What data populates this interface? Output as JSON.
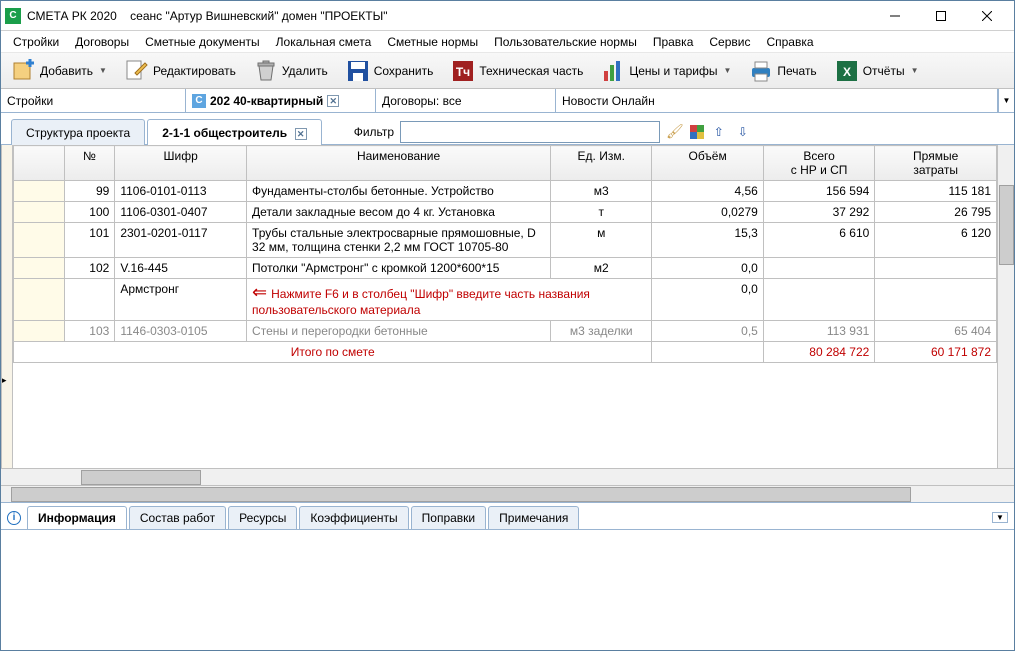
{
  "title": {
    "app": "СМЕТА РК 2020",
    "session": "сеанс \"Артур Вишневский\"  домен \"ПРОЕКТЫ\""
  },
  "menu": [
    "Стройки",
    "Договоры",
    "Сметные документы",
    "Локальная смета",
    "Сметные нормы",
    "Пользовательские нормы",
    "Правка",
    "Сервис",
    "Справка"
  ],
  "toolbar": {
    "add": "Добавить",
    "edit": "Редактировать",
    "delete": "Удалить",
    "save": "Сохранить",
    "tech": "Техническая часть",
    "prices": "Цены и тарифы",
    "print": "Печать",
    "reports": "Отчёты"
  },
  "docbar": {
    "section1": "Стройки",
    "active_doc": "202 40-квартирный",
    "contracts": "Договоры: все",
    "news": "Новости Онлайн"
  },
  "tabs": {
    "structure": "Структура проекта",
    "active": "2-1-1 общестроитель",
    "filter_label": "Фильтр"
  },
  "columns": {
    "num": "№",
    "code": "Шифр",
    "name": "Наименование",
    "unit": "Ед. Изм.",
    "volume": "Объём",
    "total": "Всего\nс НР и СП",
    "direct": "Прямые\nзатраты"
  },
  "rows": [
    {
      "num": "99",
      "code": "1106-0101-0113",
      "name": "Фундаменты-столбы бетонные. Устройство",
      "unit": "м3",
      "vol": "4,56",
      "total": "156 594",
      "direct": "115 181"
    },
    {
      "num": "100",
      "code": "1106-0301-0407",
      "name": "Детали закладные весом до 4 кг. Установка",
      "unit": "т",
      "vol": "0,0279",
      "total": "37 292",
      "direct": "26 795"
    },
    {
      "num": "101",
      "code": "2301-0201-0117",
      "name": "Трубы стальные электросварные прямошовные, D 32 мм, толщина стенки 2,2 мм ГОСТ 10705-80",
      "unit": "м",
      "vol": "15,3",
      "total": "6 610",
      "direct": "6 120"
    },
    {
      "num": "102",
      "code": "V.16-445",
      "name": "Потолки \"Армстронг\" с кромкой 1200*600*15",
      "unit": "м2",
      "vol": "0,0",
      "total": "",
      "direct": ""
    }
  ],
  "input_row": {
    "code": "Армстронг",
    "vol": "0,0"
  },
  "partial_row": {
    "num": "103",
    "code": "1146-0303-0105",
    "name": "Стены и перегородки бетонные",
    "unit": "м3 заделки",
    "vol": "0,5",
    "total": "113 931",
    "direct": "65 404"
  },
  "annotation": "Нажмите F6 и в столбец \"Шифр\" введите часть названия пользовательского материала",
  "summary": {
    "label": "Итого по смете",
    "total": "80 284 722",
    "direct": "60 171 872"
  },
  "bottom_tabs": [
    "Информация",
    "Состав работ",
    "Ресурсы",
    "Коэффициенты",
    "Поправки",
    "Примечания"
  ]
}
